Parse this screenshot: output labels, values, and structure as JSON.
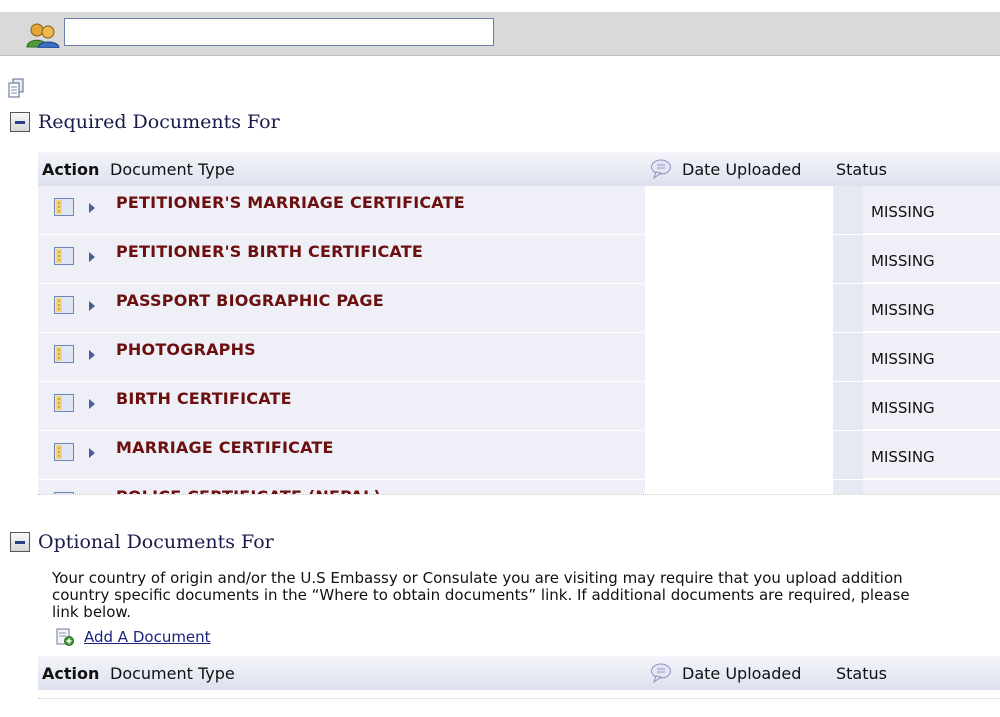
{
  "search": {
    "value": "",
    "placeholder": ""
  },
  "required": {
    "title": "Required Documents For",
    "columns": {
      "action": "Action",
      "document_type": "Document Type",
      "date_uploaded": "Date Uploaded",
      "status": "Status"
    },
    "rows": [
      {
        "name": "PETITIONER'S MARRIAGE CERTIFICATE",
        "date": "",
        "status": "MISSING"
      },
      {
        "name": "PETITIONER'S BIRTH CERTIFICATE",
        "date": "",
        "status": "MISSING"
      },
      {
        "name": "PASSPORT BIOGRAPHIC PAGE",
        "date": "",
        "status": "MISSING"
      },
      {
        "name": "PHOTOGRAPHS",
        "date": "",
        "status": "MISSING"
      },
      {
        "name": "BIRTH CERTIFICATE",
        "date": "",
        "status": "MISSING"
      },
      {
        "name": "MARRIAGE CERTIFICATE",
        "date": "",
        "status": "MISSING"
      },
      {
        "name": "POLICE CERTIFICATE (NEPAL)",
        "date": "",
        "status": ""
      }
    ]
  },
  "optional": {
    "title": "Optional Documents For",
    "description_lines": [
      "Your country of origin and/or the U.S Embassy or Consulate you are visiting may require that you upload addition",
      "country specific documents in the “Where to obtain documents” link. If additional documents are required, please",
      "link below."
    ],
    "add_link": "Add A Document",
    "columns": {
      "action": "Action",
      "document_type": "Document Type",
      "date_uploaded": "Date Uploaded",
      "status": "Status"
    }
  },
  "colors": {
    "doc_name": "#6b0f0f",
    "header_title": "#1a1a4a",
    "link": "#1a237e",
    "row_bg": "#eff0f7"
  },
  "icons": {
    "users": "users-icon",
    "copy": "copy-document-icon",
    "collapse": "collapse-minus-icon",
    "comment": "comment-bubble-icon",
    "document": "document-details-icon",
    "expand": "expand-arrow-icon",
    "add": "add-document-icon"
  }
}
